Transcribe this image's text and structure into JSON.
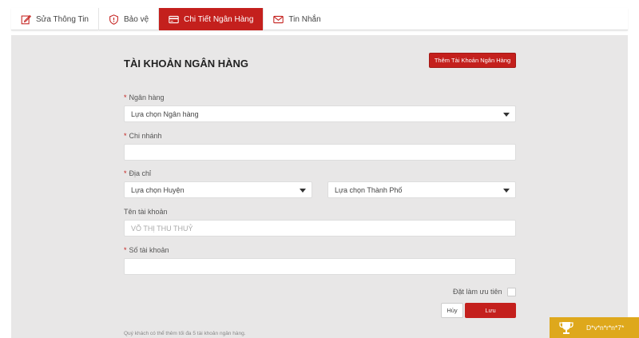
{
  "tabs": [
    {
      "label": "Sửa Thông Tin",
      "icon": "edit-icon",
      "active": false
    },
    {
      "label": "Bảo vệ",
      "icon": "shield-icon",
      "active": false
    },
    {
      "label": "Chi Tiết Ngân Hàng",
      "icon": "card-icon",
      "active": true
    },
    {
      "label": "Tin Nhắn",
      "icon": "mail-icon",
      "active": false
    }
  ],
  "form": {
    "title": "TÀI KHOẢN NGÂN HÀNG",
    "add_button": "Thêm Tài Khoản Ngân Hàng",
    "bank": {
      "label": "Ngân hàng",
      "value": "Lựa chọn Ngân hàng"
    },
    "branch": {
      "label": "Chi nhánh",
      "value": ""
    },
    "address": {
      "label": "Địa chỉ",
      "district": "Lựa chọn Huyện",
      "city": "Lựa chọn Thành Phố"
    },
    "account_name": {
      "label": "Tên tài khoản",
      "placeholder": "VÕ THỊ THU THUỶ"
    },
    "account_number": {
      "label": "Số tài khoản",
      "value": ""
    },
    "preferred_label": "Đặt làm ưu tiên",
    "cancel_button": "Hủy",
    "save_button": "Lưu",
    "note": "Quý khách có thể thêm tối đa 5 tài khoản ngân hàng."
  },
  "promo": {
    "text": "D*v*n*r*n*7*"
  },
  "colors": {
    "accent": "#c4201d",
    "panel": "#e8e7e7",
    "promo": "#dea81c"
  }
}
